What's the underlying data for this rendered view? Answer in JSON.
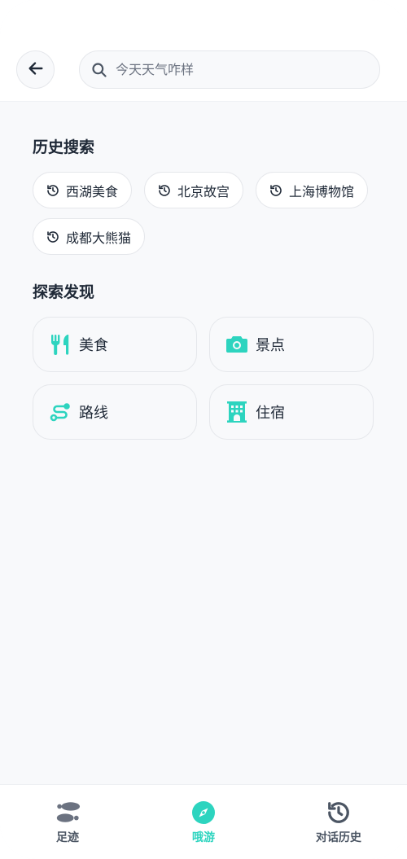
{
  "search": {
    "placeholder": "今天天气咋样"
  },
  "history": {
    "title": "历史搜索",
    "items": [
      {
        "label": "西湖美食"
      },
      {
        "label": "北京故宫"
      },
      {
        "label": "上海博物馆"
      },
      {
        "label": "成都大熊猫"
      }
    ]
  },
  "explore": {
    "title": "探索发现",
    "items": [
      {
        "label": "美食",
        "icon": "utensils-icon"
      },
      {
        "label": "景点",
        "icon": "camera-icon"
      },
      {
        "label": "路线",
        "icon": "route-icon"
      },
      {
        "label": "住宿",
        "icon": "hotel-icon"
      }
    ]
  },
  "tabbar": {
    "items": [
      {
        "label": "足迹",
        "icon": "footprints-icon",
        "active": false
      },
      {
        "label": "哦游",
        "icon": "compass-icon",
        "active": true
      },
      {
        "label": "对话历史",
        "icon": "history-icon",
        "active": false
      }
    ]
  },
  "colors": {
    "accent": "#2dd4bf",
    "text": "#1f2937",
    "muted": "#4b5563",
    "background": "#f8f9fb"
  }
}
